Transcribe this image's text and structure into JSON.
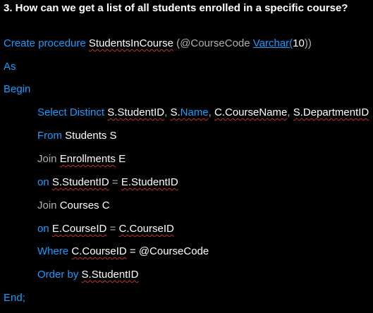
{
  "question": "3. How can we get a list of all students enrolled in a specific course?",
  "code": {
    "create_kw": "Create procedure",
    "proc_name": "StudentsInCourse",
    "param_open": "(@CourseCode",
    "type_name": "Varchar(",
    "type_size": "10",
    "param_close": "))",
    "as_kw": "As",
    "begin_kw": "Begin",
    "select_kw": "Select Distinct",
    "col1": "S.StudentID",
    "sep1": ",",
    "col2_prefix": "S.",
    "col2_name": "Name",
    "sep2": ",",
    "col3": "C.CourseName",
    "sep3": ",",
    "col4": "S.DepartmentID",
    "from_kw": "From",
    "from_tbl": "Students S",
    "join1_kw": "Join",
    "join1_tbl": "Enrollments",
    "join1_alias": "E",
    "on1_kw": "on",
    "on1_left": "S.StudentID",
    "eq1": "=",
    "on1_right": "E.StudentID",
    "join2_kw": "Join",
    "join2_tbl": "Courses C",
    "on2_kw": "on",
    "on2_left": "E.CourseID",
    "eq2": "=",
    "on2_right": "C.CourseID",
    "where_kw": "Where",
    "where_left": "C.CourseID",
    "where_rest": "= @CourseCode",
    "order_kw": "Order by",
    "order_col": "S.StudentID",
    "end_kw": "End;"
  },
  "colors": {
    "background": "#000000",
    "keyword": "#1a9cff",
    "text": "#ffffff",
    "muted": "#b0b0b0",
    "squiggle": "#c03030"
  }
}
